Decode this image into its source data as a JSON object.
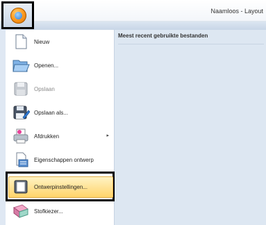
{
  "window": {
    "title": "Naamloos - Layout"
  },
  "menu": {
    "items": [
      {
        "label": "Nieuw",
        "icon": "new-document-icon"
      },
      {
        "label": "Openen...",
        "icon": "open-folder-icon"
      },
      {
        "label": "Opslaan",
        "icon": "save-icon",
        "disabled": true
      },
      {
        "label": "Opslaan als...",
        "icon": "save-as-icon"
      },
      {
        "label": "Afdrukken",
        "icon": "print-icon",
        "submenu": true
      },
      {
        "label": "Eigenschappen ontwerp",
        "icon": "design-properties-icon"
      },
      {
        "label": "Ontwerpinstellingen...",
        "icon": "design-settings-icon",
        "highlighted": true
      },
      {
        "label": "Stofkiezer...",
        "icon": "fabric-selector-icon"
      }
    ]
  },
  "recent": {
    "header": "Meest recent gebruikte bestanden"
  },
  "colors": {
    "highlight": "#ffd46a",
    "panel": "#dde7f2",
    "accent": "#ff9b1f"
  }
}
